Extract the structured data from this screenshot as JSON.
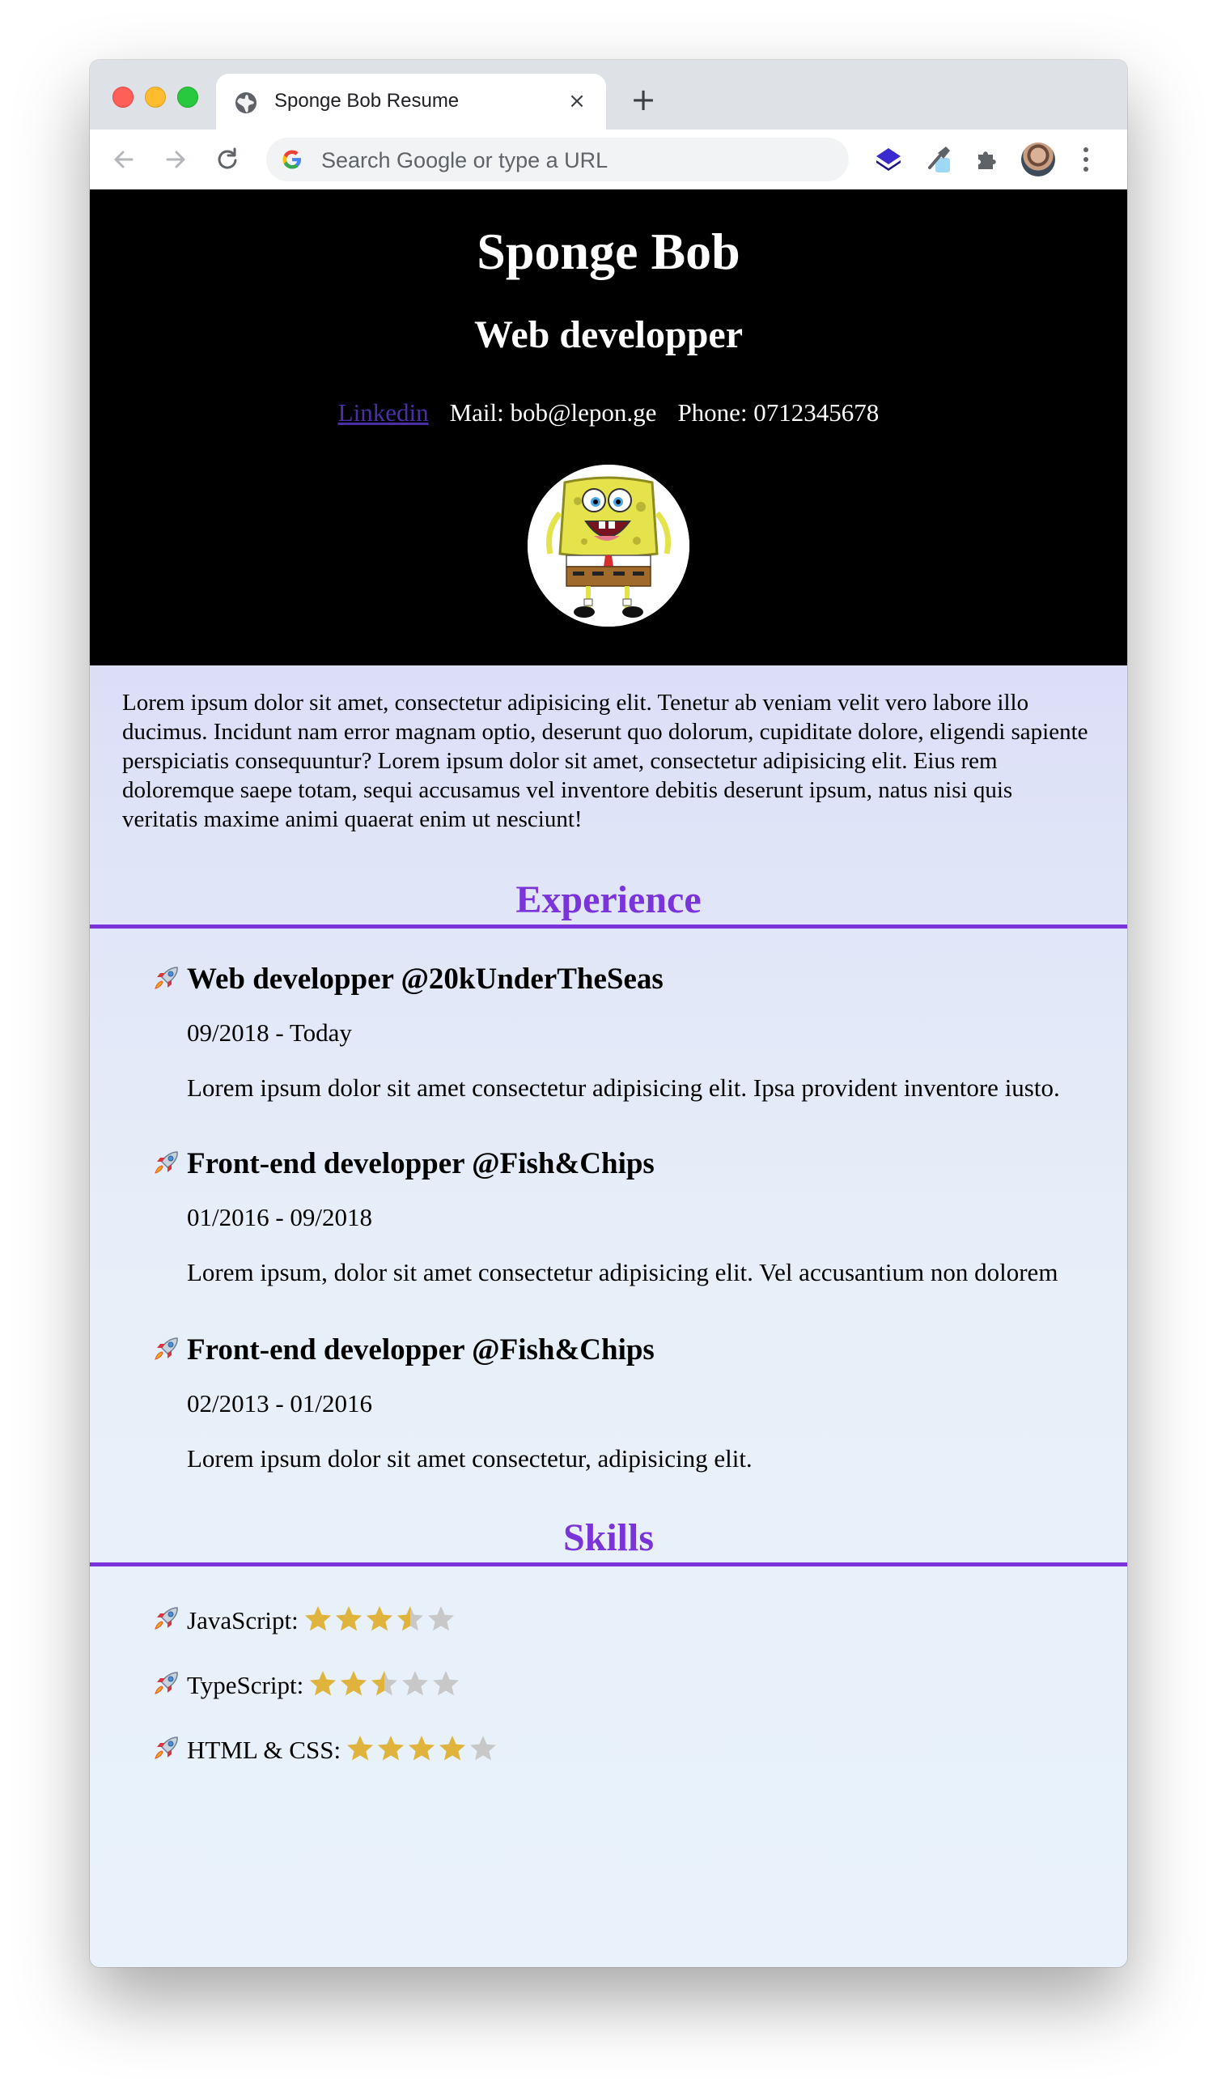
{
  "browser": {
    "tab_title": "Sponge Bob Resume",
    "omnibox_placeholder": "Search Google or type a URL"
  },
  "header": {
    "name": "Sponge Bob",
    "role": "Web developper",
    "linkedin_label": "Linkedin",
    "mail": "Mail: bob@lepon.ge",
    "phone": "Phone: 0712345678"
  },
  "about": "Lorem ipsum dolor sit amet, consectetur adipisicing elit. Tenetur ab veniam velit vero labore illo ducimus. Incidunt nam error magnam optio, deserunt quo dolorum, cupiditate dolore, eligendi sapiente perspiciatis consequuntur? Lorem ipsum dolor sit amet, consectetur adipisicing elit. Eius rem doloremque saepe totam, sequi accusamus vel inventore debitis deserunt ipsum, natus nisi quis veritatis maxime animi quaerat enim ut nesciunt!",
  "experience": {
    "heading": "Experience",
    "jobs": [
      {
        "title": "Web developper @20kUnderTheSeas",
        "dates": "09/2018 - Today",
        "description": "Lorem ipsum dolor sit amet consectetur adipisicing elit. Ipsa provident inventore iusto."
      },
      {
        "title": "Front-end developper @Fish&Chips",
        "dates": "01/2016 - 09/2018",
        "description": "Lorem ipsum, dolor sit amet consectetur adipisicing elit. Vel accusantium non dolorem"
      },
      {
        "title": "Front-end developper @Fish&Chips",
        "dates": "02/2013 - 01/2016",
        "description": "Lorem ipsum dolor sit amet consectetur, adipisicing elit."
      }
    ]
  },
  "skills": {
    "heading": "Skills",
    "items": [
      {
        "label": "JavaScript:",
        "rating": 3.5,
        "max": 5
      },
      {
        "label": "TypeScript:",
        "rating": 2.5,
        "max": 5
      },
      {
        "label": "HTML & CSS:",
        "rating": 4,
        "max": 5
      }
    ]
  },
  "colors": {
    "accent": "#7a34d9",
    "star_filled": "#e0b43c",
    "star_empty": "#c8c8c8",
    "link": "#4c2fa6"
  },
  "icons": {
    "bullet": "rocket-icon",
    "rating": "star-icon"
  }
}
